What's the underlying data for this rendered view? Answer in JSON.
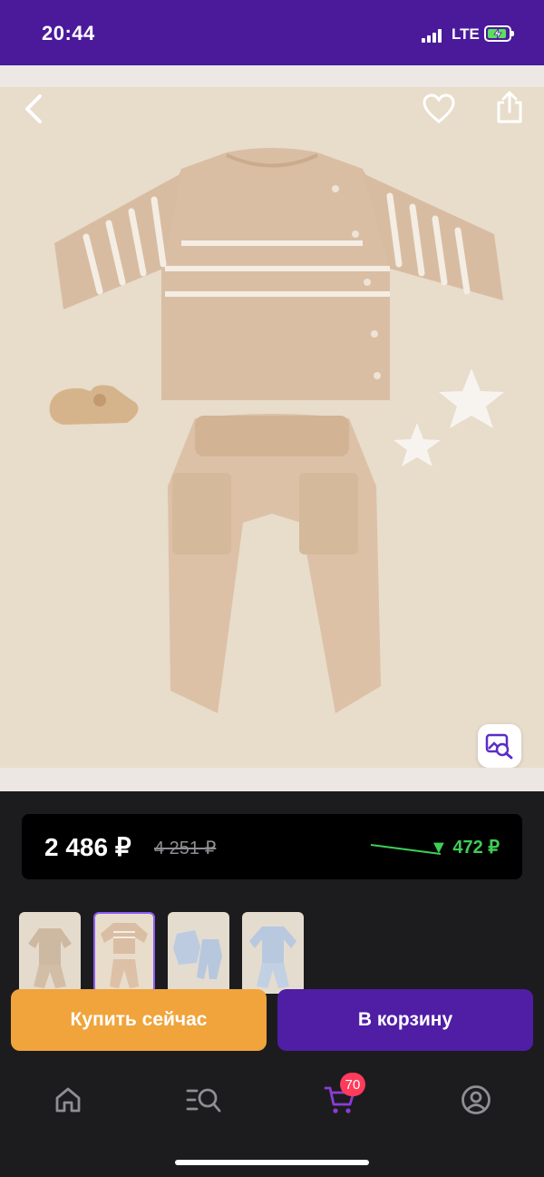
{
  "status_bar": {
    "time": "20:44",
    "network": "LTE"
  },
  "hero": {
    "alt_icons": [
      "back-icon",
      "heart-icon",
      "share-icon",
      "visual-search-icon"
    ]
  },
  "price": {
    "current": "2 486 ₽",
    "old": "4 251 ₽",
    "diff": "▼ 472 ₽",
    "diff_color": "#3ecf57"
  },
  "thumbnails": [
    {
      "name": "thumb-1",
      "active": false
    },
    {
      "name": "thumb-2",
      "active": true
    },
    {
      "name": "thumb-3",
      "active": false
    },
    {
      "name": "thumb-4",
      "active": false
    }
  ],
  "actions": {
    "buy_now": "Купить сейчас",
    "add_to_cart": "В корзину"
  },
  "tab_bar": {
    "items": [
      "home-icon",
      "catalog-search-icon",
      "cart-icon",
      "profile-icon"
    ],
    "cart_count": "70"
  },
  "colors": {
    "brand": "#4a1a9a",
    "buy": "#f0a43b",
    "cart": "#4f1ea5",
    "badge": "#ff3b5c"
  }
}
